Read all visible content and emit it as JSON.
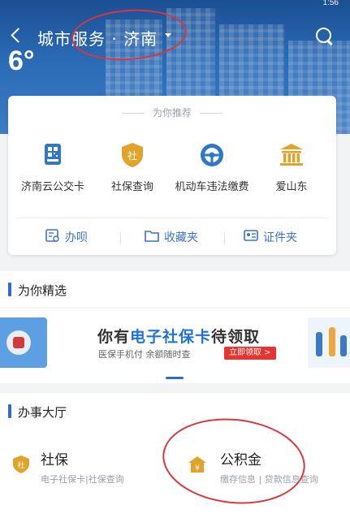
{
  "status_bar": {
    "left": "",
    "right": "1:56"
  },
  "header": {
    "back_label": "返回",
    "title": "城市服务 · 济南",
    "temperature": "6°"
  },
  "recommend": {
    "heading": "为你推荐",
    "services": [
      {
        "label": "济南云公交卡",
        "icon": "bus-card-icon"
      },
      {
        "label": "社保查询",
        "icon": "social-security-icon"
      },
      {
        "label": "机动车违法缴费",
        "icon": "steering-wheel-icon"
      },
      {
        "label": "爱山东",
        "icon": "government-building-icon"
      }
    ],
    "quick_links": [
      {
        "label": "办呗",
        "icon": "handle-icon"
      },
      {
        "label": "收藏夹",
        "icon": "folder-icon"
      },
      {
        "label": "证件夹",
        "icon": "id-card-icon"
      }
    ]
  },
  "featured": {
    "heading": "为你精选",
    "banner": {
      "title_prefix": "你有",
      "title_highlight": "电子社保卡",
      "title_suffix": "待领取",
      "subtitle": "医保手机付  余额随时查",
      "cta": "立即领取 >"
    }
  },
  "hall": {
    "heading": "办事大厅",
    "items": [
      {
        "title": "社保",
        "subtitle": "电子社保卡|社保查询"
      },
      {
        "title": "公积金",
        "subtitle": "缴存信息 | 贷款信息查询"
      }
    ]
  },
  "colors": {
    "accent": "#2d6cc8",
    "highlight": "#1f73d6",
    "badge": "#e8342f",
    "icon_gold": "#e1a32a",
    "annotation": "#d9363e"
  }
}
